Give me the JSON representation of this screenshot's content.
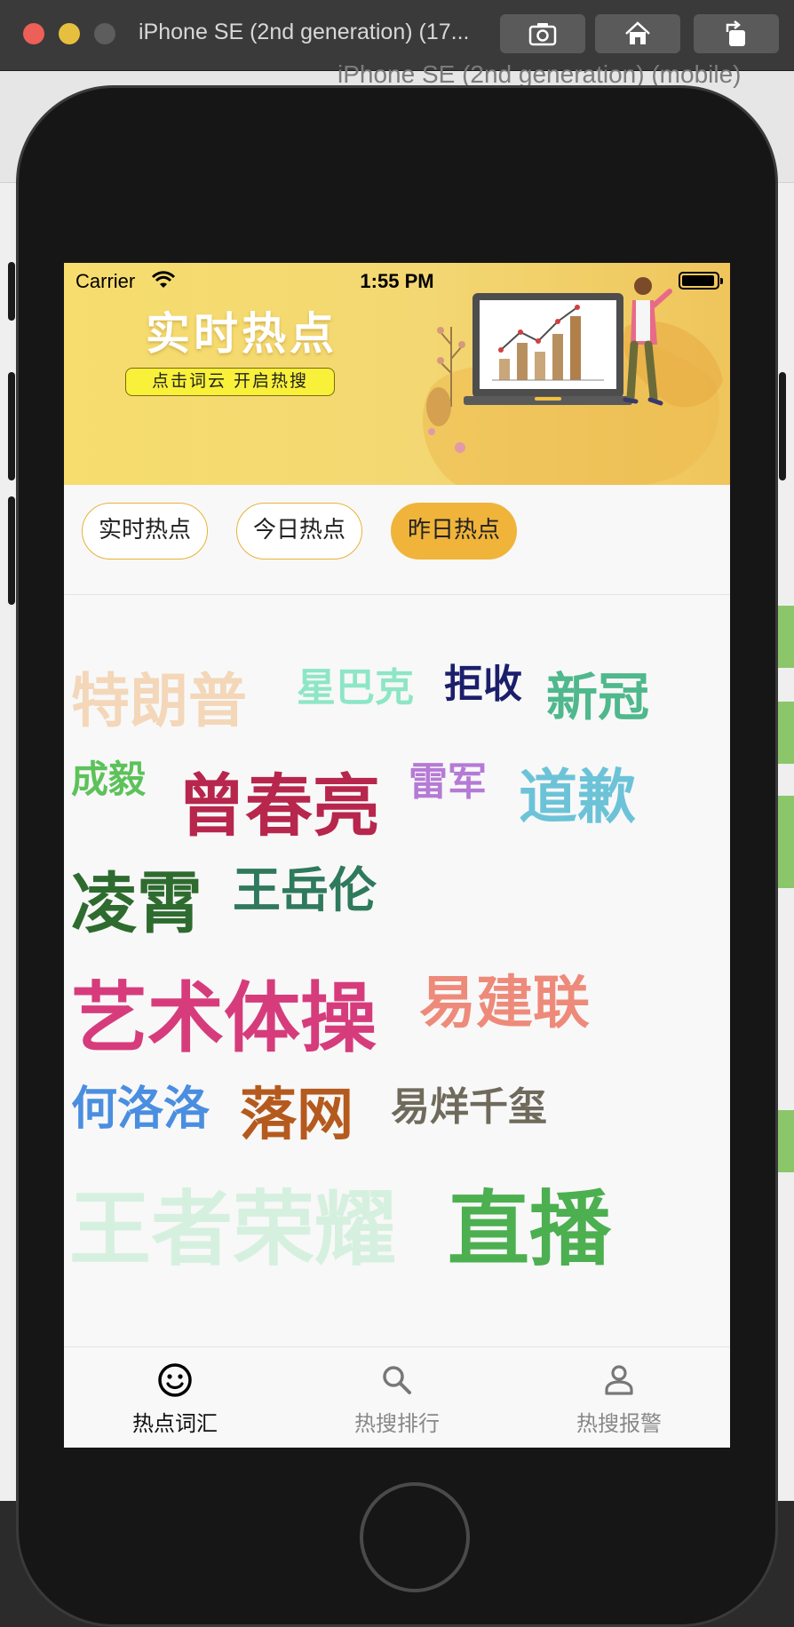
{
  "simulator": {
    "title": "iPhone SE (2nd generation) (17...",
    "background_title": "iPhone SE (2nd generation) (mobile)",
    "buttons": [
      "screenshot-icon",
      "home-icon",
      "rotate-icon"
    ]
  },
  "status_bar": {
    "carrier": "Carrier",
    "time": "1:55 PM"
  },
  "banner": {
    "title": "实时热点",
    "subtitle": "点击词云 开启热搜"
  },
  "tabs": [
    {
      "label": "实时热点",
      "active": false
    },
    {
      "label": "今日热点",
      "active": false
    },
    {
      "label": "昨日热点",
      "active": true
    }
  ],
  "word_cloud": [
    {
      "text": "特朗普",
      "color": "#f3d7b8",
      "size": 66
    },
    {
      "text": "星巴克",
      "color": "#8de6c6",
      "size": 44
    },
    {
      "text": "拒收",
      "color": "#1b1f6b",
      "size": 44
    },
    {
      "text": "新冠",
      "color": "#4fb88c",
      "size": 58
    },
    {
      "text": "成毅",
      "color": "#5cc25a",
      "size": 42
    },
    {
      "text": "曾春亮",
      "color": "#b7264c",
      "size": 76
    },
    {
      "text": "雷军",
      "color": "#b57ad6",
      "size": 44
    },
    {
      "text": "道歉",
      "color": "#6cc3d8",
      "size": 66
    },
    {
      "text": "凌霄",
      "color": "#2e6b2f",
      "size": 74
    },
    {
      "text": "王岳伦",
      "color": "#2f7a5c",
      "size": 54
    },
    {
      "text": "艺术体操",
      "color": "#d63c7c",
      "size": 86
    },
    {
      "text": "易建联",
      "color": "#ee8a7a",
      "size": 64
    },
    {
      "text": "何洛洛",
      "color": "#4a8ee0",
      "size": 52
    },
    {
      "text": "落网",
      "color": "#b55a1e",
      "size": 64
    },
    {
      "text": "易烊千玺",
      "color": "#6f6a5c",
      "size": 44
    },
    {
      "text": "王者荣耀",
      "color": "#d6f0df",
      "size": 92
    },
    {
      "text": "直播",
      "color": "#4caf50",
      "size": 92
    }
  ],
  "tabbar": [
    {
      "label": "热点词汇",
      "icon": "smiley-icon",
      "active": true
    },
    {
      "label": "热搜排行",
      "icon": "search-icon",
      "active": false
    },
    {
      "label": "热搜报警",
      "icon": "user-icon",
      "active": false
    }
  ]
}
